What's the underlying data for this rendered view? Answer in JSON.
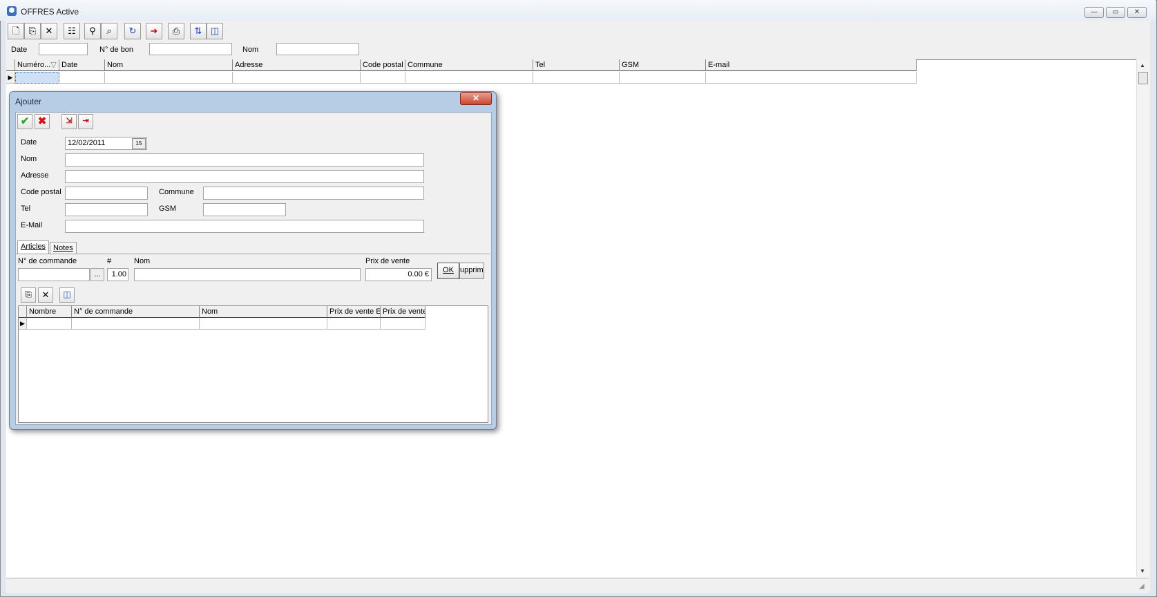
{
  "window": {
    "title": "OFFRES Active",
    "controls": {
      "minimize": "—",
      "maximize": "▭",
      "close": "✕"
    }
  },
  "toolbar": {
    "icons": [
      "new-icon",
      "copy-icon",
      "delete-icon",
      "properties-icon",
      "filter-icon",
      "find-icon",
      "refresh-icon",
      "export-icon",
      "print-icon",
      "sort-icon",
      "columns-icon"
    ]
  },
  "filters": {
    "date_label": "Date",
    "bon_label": "N° de bon",
    "nom_label": "Nom",
    "date_value": "",
    "bon_value": "",
    "nom_value": ""
  },
  "grid": {
    "columns": [
      "Numéro...",
      "Date",
      "Nom",
      "Adresse",
      "Code postal",
      "Commune",
      "Tel",
      "GSM",
      "E-mail"
    ],
    "sort_indicator": "▽"
  },
  "dialog": {
    "title": "Ajouter",
    "close": "✕",
    "fields": {
      "date_label": "Date",
      "date_value": "12/02/2011",
      "calendar_glyph": "15",
      "nom_label": "Nom",
      "adresse_label": "Adresse",
      "code_postal_label": "Code postal",
      "commune_label": "Commune",
      "tel_label": "Tel",
      "gsm_label": "GSM",
      "email_label": "E-Mail"
    },
    "tabs": [
      "Articles",
      "Notes"
    ],
    "articles": {
      "commande_label": "N° de commande",
      "qty_label": "#",
      "nom_label": "Nom",
      "prix_label": "Prix de vente",
      "commande_value": "",
      "browse": "...",
      "qty_value": "1.00",
      "nom_value": "",
      "prix_value": "0.00 €",
      "ok_label": "OK",
      "supprimer_label": "upprim"
    },
    "sub_grid": {
      "columns": [
        "Nombre",
        "N° de commande",
        "Nom",
        "Prix de vente Ex",
        "Prix de vente"
      ]
    }
  },
  "colors": {
    "dialog_frame": "#b7cde5",
    "close_red": "#c9462f",
    "check_green": "#2fa62f",
    "cross_red": "#d01515"
  }
}
